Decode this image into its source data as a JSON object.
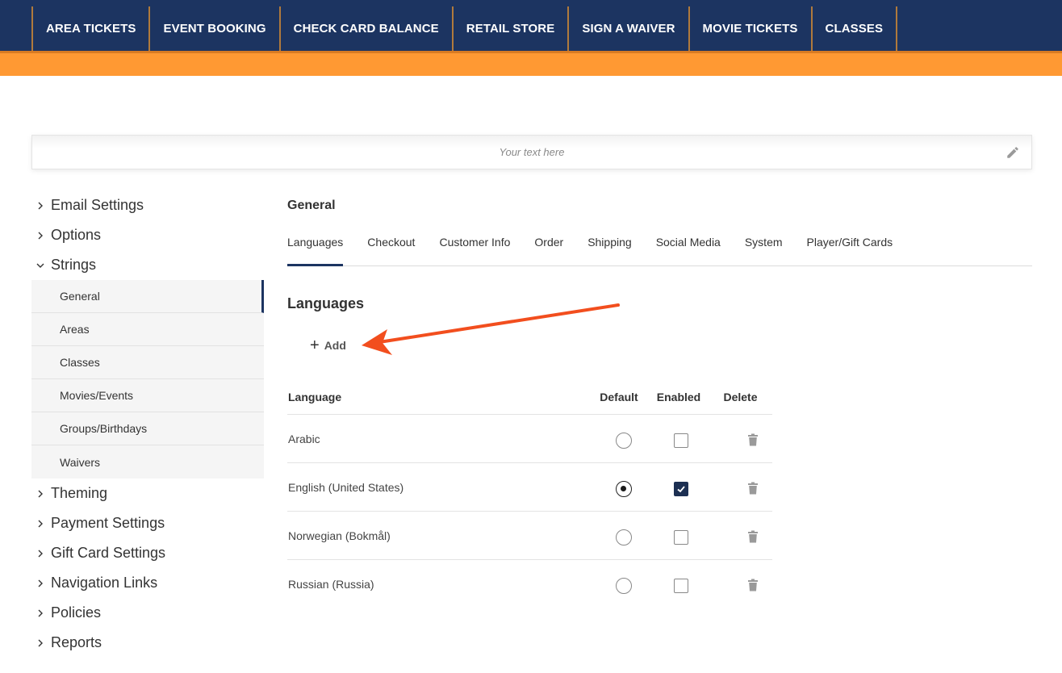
{
  "nav": {
    "items": [
      {
        "label": "AREA TICKETS"
      },
      {
        "label": "EVENT BOOKING"
      },
      {
        "label": "CHECK CARD BALANCE"
      },
      {
        "label": "RETAIL STORE"
      },
      {
        "label": "SIGN A WAIVER"
      },
      {
        "label": "MOVIE TICKETS"
      },
      {
        "label": "CLASSES"
      }
    ]
  },
  "banner": {
    "placeholder_text": "Your text here"
  },
  "sidebar": {
    "top_items": [
      {
        "label": "Email Settings"
      },
      {
        "label": "Options"
      },
      {
        "label": "Strings"
      }
    ],
    "strings_sub": [
      {
        "label": "General"
      },
      {
        "label": "Areas"
      },
      {
        "label": "Classes"
      },
      {
        "label": "Movies/Events"
      },
      {
        "label": "Groups/Birthdays"
      },
      {
        "label": "Waivers"
      }
    ],
    "bottom_items": [
      {
        "label": "Theming"
      },
      {
        "label": "Payment Settings"
      },
      {
        "label": "Gift Card Settings"
      },
      {
        "label": "Navigation Links"
      },
      {
        "label": "Policies"
      },
      {
        "label": "Reports"
      }
    ]
  },
  "main": {
    "section_title": "General",
    "tabs": [
      {
        "label": "Languages"
      },
      {
        "label": "Checkout"
      },
      {
        "label": "Customer Info"
      },
      {
        "label": "Order"
      },
      {
        "label": "Shipping"
      },
      {
        "label": "Social Media"
      },
      {
        "label": "System"
      },
      {
        "label": "Player/Gift Cards"
      }
    ],
    "languages_title": "Languages",
    "add_label": "Add"
  },
  "table": {
    "headers": {
      "language": "Language",
      "default": "Default",
      "enabled": "Enabled",
      "delete": "Delete"
    },
    "rows": [
      {
        "language": "Arabic",
        "default": false,
        "enabled": false
      },
      {
        "language": "English (United States)",
        "default": true,
        "enabled": true
      },
      {
        "language": "Norwegian (Bokmål)",
        "default": false,
        "enabled": false
      },
      {
        "language": "Russian (Russia)",
        "default": false,
        "enabled": false
      }
    ]
  },
  "colors": {
    "nav_bg": "#1c3461",
    "nav_divider": "#b07a3c",
    "orange_band": "#ff9933",
    "annotation_arrow": "#f24e1e"
  },
  "icons": {
    "banner_edit": "pencil-icon",
    "sidebar_collapsed": "chevron-right-icon",
    "sidebar_expanded": "chevron-down-icon",
    "add": "plus-icon",
    "delete": "trash-icon",
    "enabled_check": "checkmark-icon"
  }
}
